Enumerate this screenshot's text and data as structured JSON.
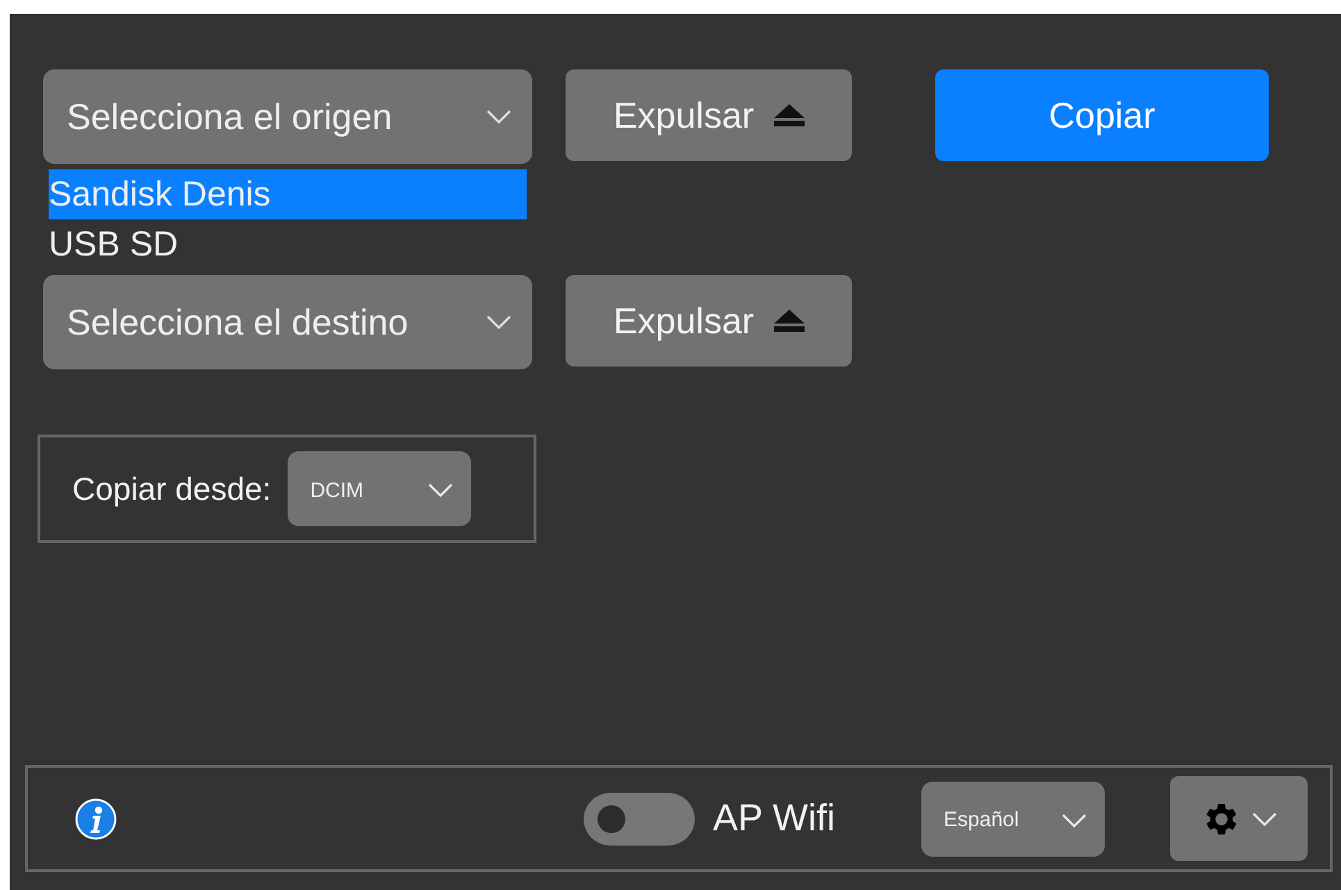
{
  "source": {
    "placeholder": "Selecciona el origen",
    "expanded": true,
    "options": [
      {
        "label": "Sandisk Denis",
        "selected": true
      },
      {
        "label": "USB SD",
        "selected": false
      }
    ]
  },
  "eject_source": {
    "label": "Expulsar"
  },
  "copy_button": {
    "label": "Copiar"
  },
  "destination": {
    "placeholder": "Selecciona el destino",
    "expanded": false
  },
  "eject_destination": {
    "label": "Expulsar"
  },
  "copy_from": {
    "label": "Copiar desde:",
    "value": "DCIM"
  },
  "footer": {
    "ap_wifi": {
      "label": "AP Wifi",
      "on": false
    },
    "language": {
      "value": "Español"
    }
  }
}
